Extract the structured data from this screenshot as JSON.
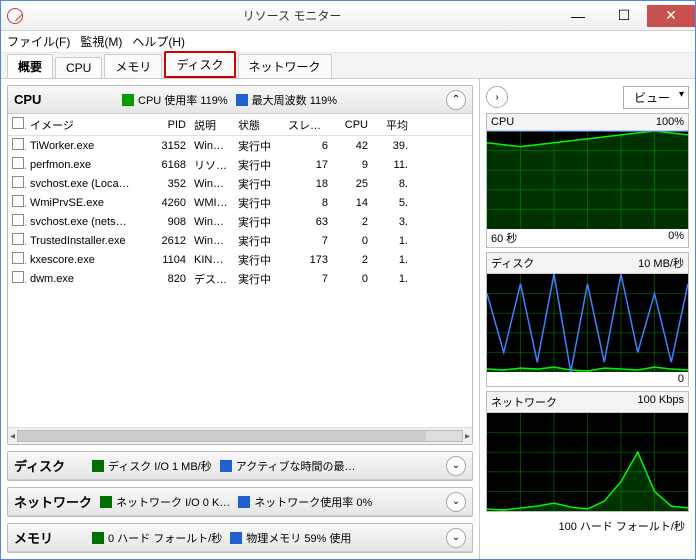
{
  "window": {
    "title": "リソース モニター"
  },
  "menu": {
    "file": "ファイル(F)",
    "monitor": "監視(M)",
    "help": "ヘルプ(H)"
  },
  "tabs": {
    "overview": "概要",
    "cpu": "CPU",
    "memory": "メモリ",
    "disk": "ディスク",
    "network": "ネットワーク"
  },
  "cpu_panel": {
    "title": "CPU",
    "usage_label": "CPU 使用率 119%",
    "maxfreq_label": "最大周波数 119%",
    "headers": {
      "image": "イメージ",
      "pid": "PID",
      "desc": "説明",
      "status": "状態",
      "threads": "スレッド",
      "cpu": "CPU",
      "avg": "平均"
    },
    "rows": [
      {
        "image": "TiWorker.exe",
        "pid": "3152",
        "desc": "Win…",
        "status": "実行中",
        "threads": "6",
        "cpu": "42",
        "avg": "39."
      },
      {
        "image": "perfmon.exe",
        "pid": "6168",
        "desc": "リソ…",
        "status": "実行中",
        "threads": "17",
        "cpu": "9",
        "avg": "11."
      },
      {
        "image": "svchost.exe (Loca…",
        "pid": "352",
        "desc": "Win…",
        "status": "実行中",
        "threads": "18",
        "cpu": "25",
        "avg": "8."
      },
      {
        "image": "WmiPrvSE.exe",
        "pid": "4260",
        "desc": "WMI…",
        "status": "実行中",
        "threads": "8",
        "cpu": "14",
        "avg": "5."
      },
      {
        "image": "svchost.exe (nets…",
        "pid": "908",
        "desc": "Win…",
        "status": "実行中",
        "threads": "63",
        "cpu": "2",
        "avg": "3."
      },
      {
        "image": "TrustedInstaller.exe",
        "pid": "2612",
        "desc": "Win…",
        "status": "実行中",
        "threads": "7",
        "cpu": "0",
        "avg": "1."
      },
      {
        "image": "kxescore.exe",
        "pid": "1104",
        "desc": "KIN…",
        "status": "実行中",
        "threads": "173",
        "cpu": "2",
        "avg": "1."
      },
      {
        "image": "dwm.exe",
        "pid": "820",
        "desc": "デス…",
        "status": "実行中",
        "threads": "7",
        "cpu": "0",
        "avg": "1."
      }
    ]
  },
  "disk_panel": {
    "title": "ディスク",
    "io_label": "ディスク I/O 1 MB/秒",
    "active_label": "アクティブな時間の最…"
  },
  "network_panel": {
    "title": "ネットワーク",
    "io_label": "ネットワーク I/O 0 K…",
    "usage_label": "ネットワーク使用率 0%"
  },
  "memory_panel": {
    "title": "メモリ",
    "fault_label": "0 ハード フォールト/秒",
    "phys_label": "物理メモリ 59% 使用"
  },
  "right": {
    "view_label": "ビュー",
    "charts": [
      {
        "title": "CPU",
        "right": "100%",
        "foot_left": "60 秒",
        "foot_right": "0%"
      },
      {
        "title": "ディスク",
        "right": "10 MB/秒",
        "foot_left": "",
        "foot_right": "0"
      },
      {
        "title": "ネットワーク",
        "right": "100 Kbps",
        "foot_left": "",
        "foot_right": ""
      }
    ],
    "bottom_label": "100 ハード フォールト/秒"
  },
  "chart_data": [
    {
      "type": "area",
      "title": "CPU",
      "ylabel": "%",
      "ylim": [
        0,
        100
      ],
      "x": [
        0,
        5,
        10,
        15,
        20,
        25,
        30,
        35,
        40,
        45,
        50,
        55,
        60
      ],
      "series": [
        {
          "name": "CPU 使用率",
          "color": "#00ff00",
          "values": [
            88,
            86,
            84,
            86,
            88,
            90,
            92,
            94,
            96,
            98,
            100,
            98,
            96
          ]
        },
        {
          "name": "最大周波数",
          "color": "#4080ff",
          "values": [
            100,
            100,
            100,
            100,
            100,
            100,
            100,
            100,
            100,
            100,
            100,
            100,
            100
          ]
        }
      ]
    },
    {
      "type": "area",
      "title": "ディスク",
      "ylabel": "MB/秒",
      "ylim": [
        0,
        10
      ],
      "x": [
        0,
        5,
        10,
        15,
        20,
        25,
        30,
        35,
        40,
        45,
        50,
        55,
        60
      ],
      "series": [
        {
          "name": "I/O",
          "color": "#00ff00",
          "values": [
            0.3,
            0.2,
            0.4,
            0.3,
            0.5,
            0.2,
            0.1,
            0.4,
            0.3,
            0.2,
            0.5,
            0.3,
            0.2
          ]
        },
        {
          "name": "アクティブな時間",
          "color": "#4080ff",
          "values": [
            8,
            2,
            9,
            1,
            10,
            0,
            9,
            1,
            10,
            2,
            8,
            1,
            9
          ]
        }
      ]
    },
    {
      "type": "area",
      "title": "ネットワーク",
      "ylabel": "Kbps",
      "ylim": [
        0,
        100
      ],
      "x": [
        0,
        5,
        10,
        15,
        20,
        25,
        30,
        35,
        40,
        45,
        50,
        55,
        60
      ],
      "series": [
        {
          "name": "I/O",
          "color": "#00ff00",
          "values": [
            2,
            1,
            3,
            5,
            8,
            4,
            2,
            10,
            30,
            60,
            20,
            5,
            3
          ]
        }
      ]
    }
  ]
}
